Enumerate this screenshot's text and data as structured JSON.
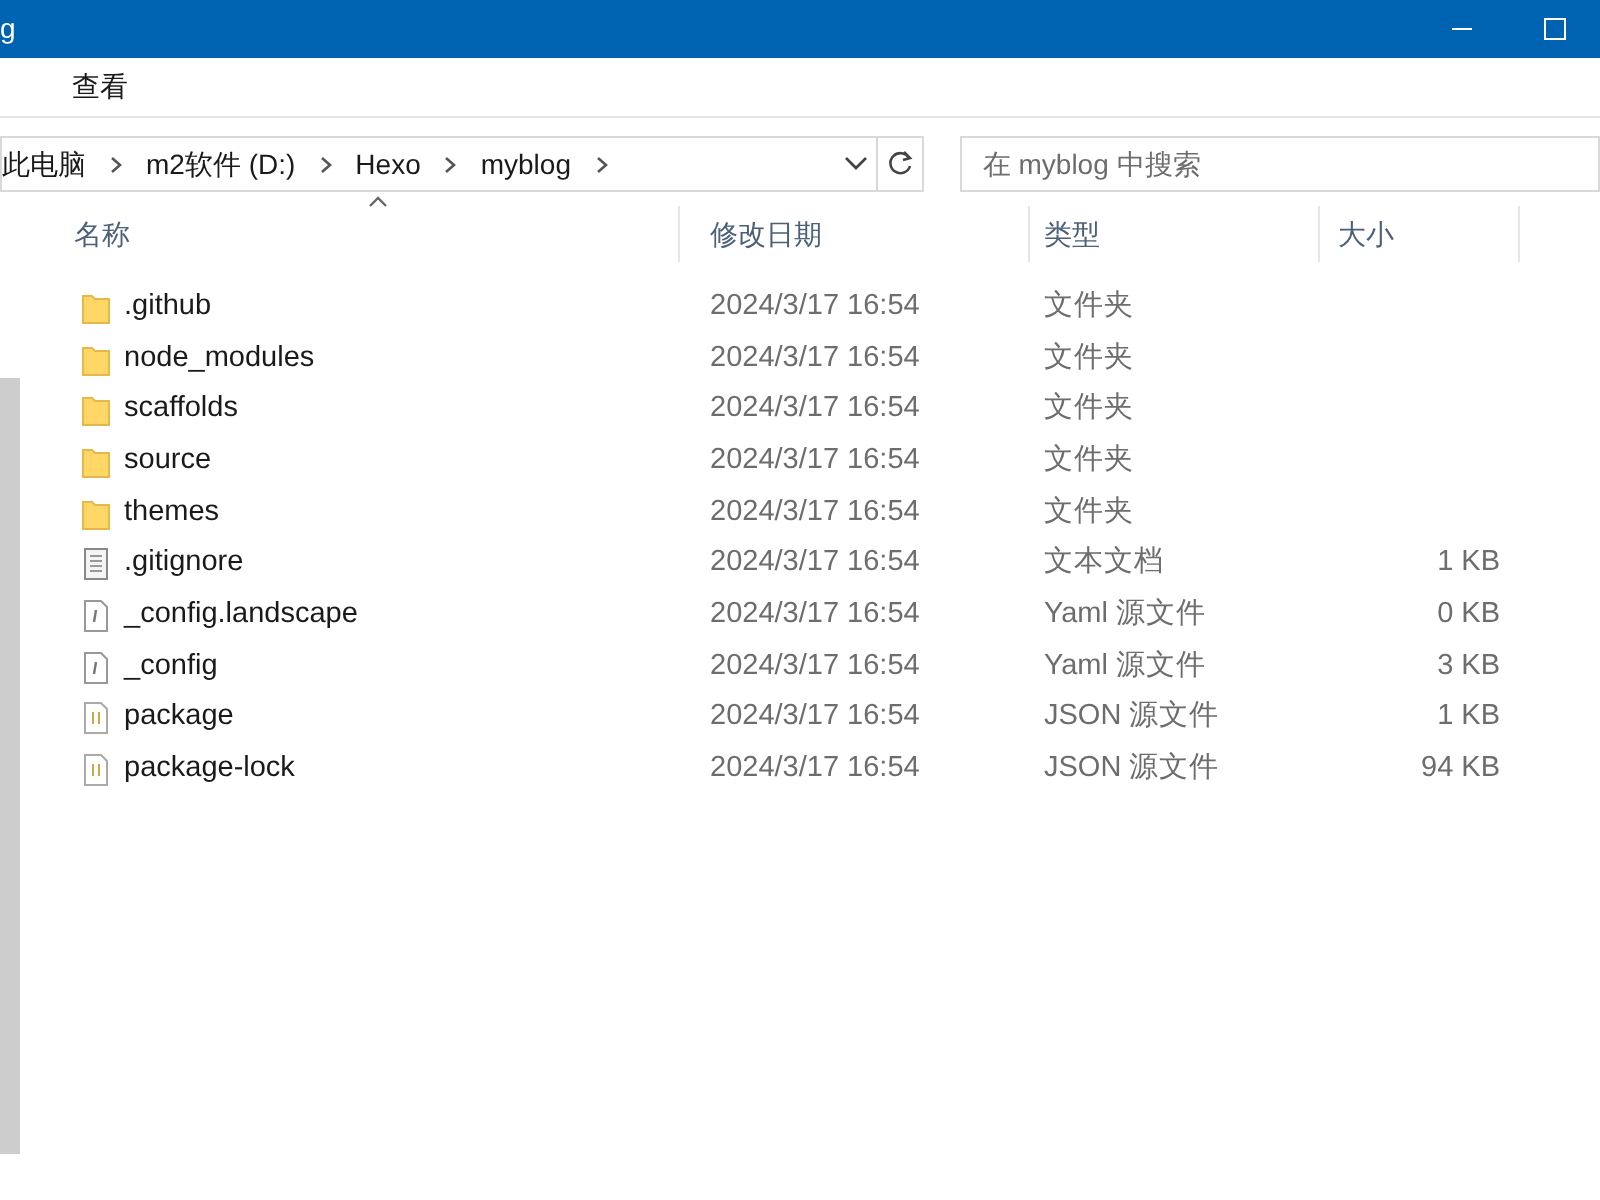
{
  "window": {
    "title": "g"
  },
  "menu": [
    "查看"
  ],
  "address": {
    "crumbs": [
      "此电脑",
      "m2软件 (D:)",
      "Hexo",
      "myblog"
    ]
  },
  "search": {
    "placeholder": "在 myblog 中搜索"
  },
  "table": {
    "columns": [
      "名称",
      "修改日期",
      "类型",
      "大小"
    ],
    "rows": [
      {
        "kind": "folder",
        "name": ".github",
        "date": "2024/3/17 16:54",
        "type": "文件夹"
      },
      {
        "kind": "folder",
        "name": "node_modules",
        "date": "2024/3/17 16:54",
        "type": "文件夹"
      },
      {
        "kind": "folder",
        "name": "scaffolds",
        "date": "2024/3/17 16:54",
        "type": "文件夹"
      },
      {
        "kind": "folder",
        "name": "source",
        "date": "2024/3/17 16:54",
        "type": "文件夹"
      },
      {
        "kind": "folder",
        "name": "themes",
        "date": "2024/3/17 16:54",
        "type": "文件夹"
      },
      {
        "kind": "text",
        "name": ".gitignore",
        "date": "2024/3/17 16:54",
        "type": "文本文档",
        "size": "1 KB"
      },
      {
        "kind": "yaml",
        "name": "_config.landscape",
        "date": "2024/3/17 16:54",
        "type": "Yaml 源文件",
        "size": "0 KB"
      },
      {
        "kind": "yaml",
        "name": "_config",
        "date": "2024/3/17 16:54",
        "type": "Yaml 源文件",
        "size": "3 KB"
      },
      {
        "kind": "json",
        "name": "package",
        "date": "2024/3/17 16:54",
        "type": "JSON 源文件",
        "size": "1 KB"
      },
      {
        "kind": "json",
        "name": "package-lock",
        "date": "2024/3/17 16:54",
        "type": "JSON 源文件",
        "size": "94 KB"
      }
    ]
  }
}
